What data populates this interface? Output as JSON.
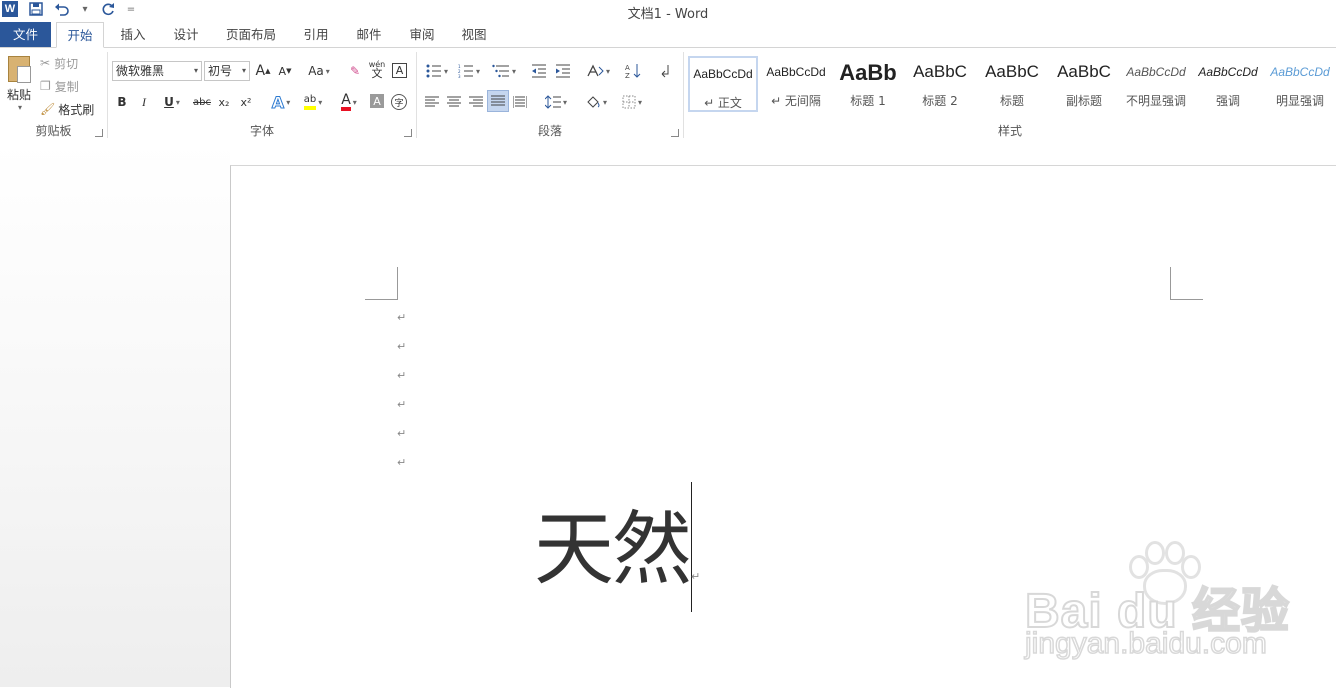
{
  "window": {
    "title": "文档1 - Word"
  },
  "quick_access": {
    "customize_label": "="
  },
  "tabs": [
    "文件",
    "开始",
    "插入",
    "设计",
    "页面布局",
    "引用",
    "邮件",
    "审阅",
    "视图"
  ],
  "clipboard": {
    "paste": "粘贴",
    "cut": "剪切",
    "copy": "复制",
    "format_painter": "格式刷",
    "group_label": "剪贴板"
  },
  "font": {
    "name": "微软雅黑",
    "size": "初号",
    "grow": "A",
    "shrink": "A",
    "case": "Aa",
    "phonetic_top": "wén",
    "phonetic_bottom": "文",
    "border_char": "A",
    "bold": "B",
    "italic": "I",
    "underline": "U",
    "strike": "abc",
    "subscript": "x₂",
    "superscript": "x²",
    "effects": "A",
    "highlight": "ab",
    "color": "A",
    "shading": "A",
    "enclose": "字",
    "group_label": "字体",
    "font_color_hex": "#e81123",
    "highlight_hex": "#ffff00"
  },
  "paragraph": {
    "group_label": "段落"
  },
  "styles": {
    "group_label": "样式",
    "items": [
      {
        "sample": "AaBbCcDd",
        "name": "↵ 正文"
      },
      {
        "sample": "AaBbCcDd",
        "name": "↵ 无间隔"
      },
      {
        "sample": "AaBb",
        "name": "标题 1"
      },
      {
        "sample": "AaBbC",
        "name": "标题 2"
      },
      {
        "sample": "AaBbC",
        "name": "标题"
      },
      {
        "sample": "AaBbC",
        "name": "副标题"
      },
      {
        "sample": "AaBbCcDd",
        "name": "不明显强调"
      },
      {
        "sample": "AaBbCcDd",
        "name": "强调"
      },
      {
        "sample": "AaBbCcDd",
        "name": "明显强调"
      }
    ]
  },
  "document": {
    "paragraph_mark": "↵",
    "empty_paragraphs": 6,
    "text": "天然"
  },
  "watermark": {
    "brand": "Bai du 经验",
    "url": "jingyan.baidu.com"
  },
  "colors": {
    "accent": "#2b579a",
    "selected_align": "#c5d6ef"
  }
}
